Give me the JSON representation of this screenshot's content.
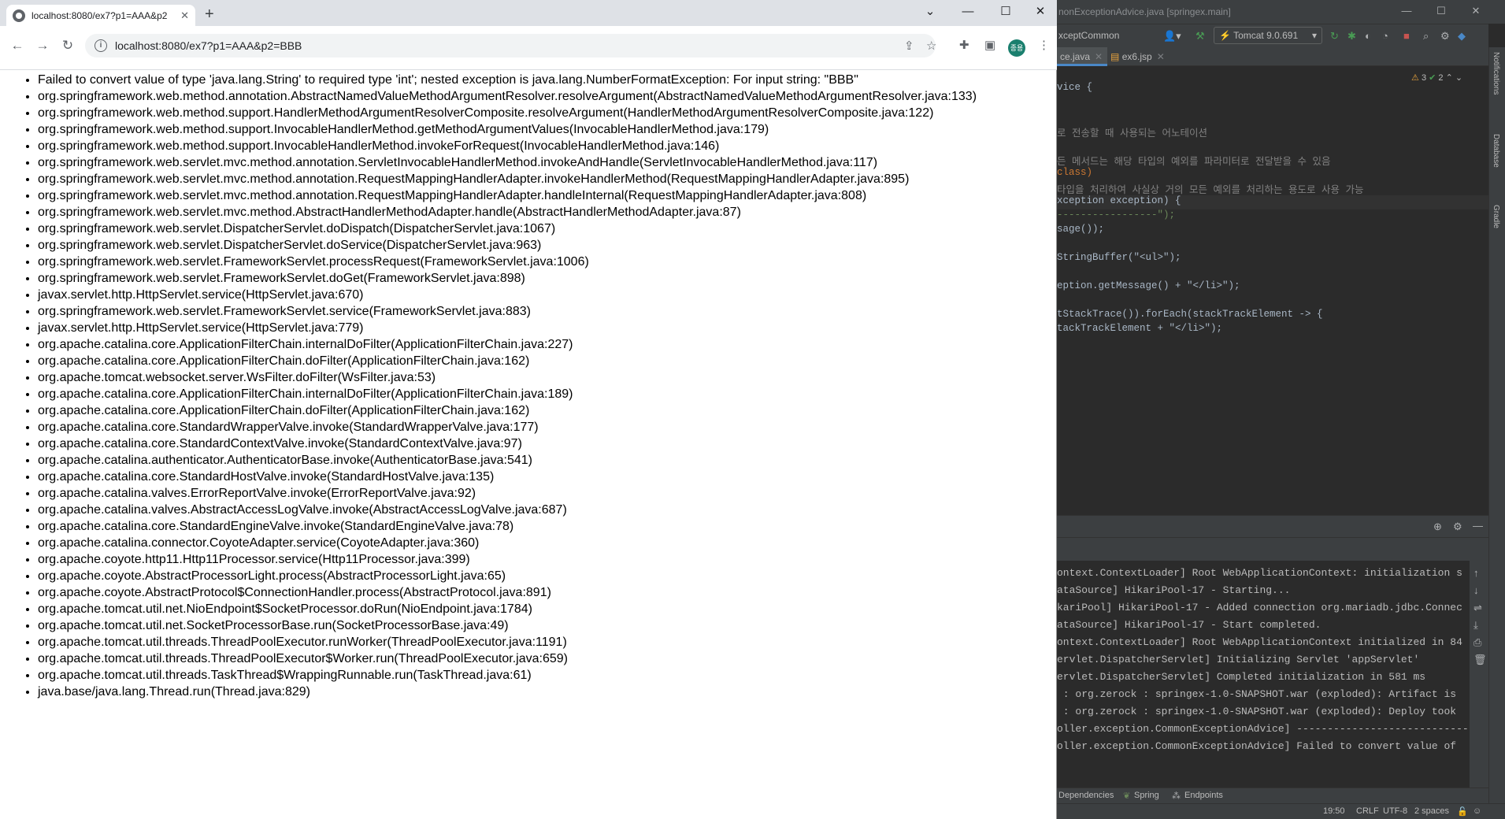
{
  "browser": {
    "tab_title": "localhost:8080/ex7?p1=AAA&p2",
    "url": "localhost:8080/ex7?p1=AAA&p2=BBB",
    "avatar_text": "종용",
    "icons": {
      "favicon": "globe-icon",
      "tab_close": "close-icon",
      "new_tab": "plus-icon",
      "back": "arrow-left-icon",
      "forward": "arrow-right-icon",
      "reload": "reload-icon",
      "site_info": "info-icon",
      "share": "share-icon",
      "bookmark": "star-icon",
      "extensions": "puzzle-icon",
      "side_panel": "side-panel-icon",
      "menu": "kebab-menu-icon"
    },
    "stack_trace": [
      "Failed to convert value of type 'java.lang.String' to required type 'int'; nested exception is java.lang.NumberFormatException: For input string: \"BBB\"",
      "org.springframework.web.method.annotation.AbstractNamedValueMethodArgumentResolver.resolveArgument(AbstractNamedValueMethodArgumentResolver.java:133)",
      "org.springframework.web.method.support.HandlerMethodArgumentResolverComposite.resolveArgument(HandlerMethodArgumentResolverComposite.java:122)",
      "org.springframework.web.method.support.InvocableHandlerMethod.getMethodArgumentValues(InvocableHandlerMethod.java:179)",
      "org.springframework.web.method.support.InvocableHandlerMethod.invokeForRequest(InvocableHandlerMethod.java:146)",
      "org.springframework.web.servlet.mvc.method.annotation.ServletInvocableHandlerMethod.invokeAndHandle(ServletInvocableHandlerMethod.java:117)",
      "org.springframework.web.servlet.mvc.method.annotation.RequestMappingHandlerAdapter.invokeHandlerMethod(RequestMappingHandlerAdapter.java:895)",
      "org.springframework.web.servlet.mvc.method.annotation.RequestMappingHandlerAdapter.handleInternal(RequestMappingHandlerAdapter.java:808)",
      "org.springframework.web.servlet.mvc.method.AbstractHandlerMethodAdapter.handle(AbstractHandlerMethodAdapter.java:87)",
      "org.springframework.web.servlet.DispatcherServlet.doDispatch(DispatcherServlet.java:1067)",
      "org.springframework.web.servlet.DispatcherServlet.doService(DispatcherServlet.java:963)",
      "org.springframework.web.servlet.FrameworkServlet.processRequest(FrameworkServlet.java:1006)",
      "org.springframework.web.servlet.FrameworkServlet.doGet(FrameworkServlet.java:898)",
      "javax.servlet.http.HttpServlet.service(HttpServlet.java:670)",
      "org.springframework.web.servlet.FrameworkServlet.service(FrameworkServlet.java:883)",
      "javax.servlet.http.HttpServlet.service(HttpServlet.java:779)",
      "org.apache.catalina.core.ApplicationFilterChain.internalDoFilter(ApplicationFilterChain.java:227)",
      "org.apache.catalina.core.ApplicationFilterChain.doFilter(ApplicationFilterChain.java:162)",
      "org.apache.tomcat.websocket.server.WsFilter.doFilter(WsFilter.java:53)",
      "org.apache.catalina.core.ApplicationFilterChain.internalDoFilter(ApplicationFilterChain.java:189)",
      "org.apache.catalina.core.ApplicationFilterChain.doFilter(ApplicationFilterChain.java:162)",
      "org.apache.catalina.core.StandardWrapperValve.invoke(StandardWrapperValve.java:177)",
      "org.apache.catalina.core.StandardContextValve.invoke(StandardContextValve.java:97)",
      "org.apache.catalina.authenticator.AuthenticatorBase.invoke(AuthenticatorBase.java:541)",
      "org.apache.catalina.core.StandardHostValve.invoke(StandardHostValve.java:135)",
      "org.apache.catalina.valves.ErrorReportValve.invoke(ErrorReportValve.java:92)",
      "org.apache.catalina.valves.AbstractAccessLogValve.invoke(AbstractAccessLogValve.java:687)",
      "org.apache.catalina.core.StandardEngineValve.invoke(StandardEngineValve.java:78)",
      "org.apache.catalina.connector.CoyoteAdapter.service(CoyoteAdapter.java:360)",
      "org.apache.coyote.http11.Http11Processor.service(Http11Processor.java:399)",
      "org.apache.coyote.AbstractProcessorLight.process(AbstractProcessorLight.java:65)",
      "org.apache.coyote.AbstractProtocol$ConnectionHandler.process(AbstractProtocol.java:891)",
      "org.apache.tomcat.util.net.NioEndpoint$SocketProcessor.doRun(NioEndpoint.java:1784)",
      "org.apache.tomcat.util.net.SocketProcessorBase.run(SocketProcessorBase.java:49)",
      "org.apache.tomcat.util.threads.ThreadPoolExecutor.runWorker(ThreadPoolExecutor.java:1191)",
      "org.apache.tomcat.util.threads.ThreadPoolExecutor$Worker.run(ThreadPoolExecutor.java:659)",
      "org.apache.tomcat.util.threads.TaskThread$WrappingRunnable.run(TaskThread.java:61)",
      "java.base/java.lang.Thread.run(Thread.java:829)"
    ]
  },
  "ide": {
    "window_title": "nonExceptionAdvice.java [springex.main]",
    "config_name": "xceptCommon",
    "run_config": "Tomcat 9.0.691",
    "tabs": [
      "ce.java",
      "ex6.jsp"
    ],
    "inspection": {
      "warnings": "3",
      "ok": "2"
    },
    "code_lines": [
      "vice {",
      "",
      "",
      "로 전송할 때 사용되는 어노테이션",
      "",
      "든 메서드는 해당 타입의 예외를 파라미터로 전달받을 수 있음",
      "class)",
      "타입을 처리하여 사실상 거의 모든 예외를 처리하는 용도로 사용 가능",
      "xception exception) {",
      "-----------------\");",
      "sage());",
      "",
      "StringBuffer(\"<ul>\");",
      "",
      "eption.getMessage() + \"</li>\");",
      "",
      "tStackTrace()).forEach(stackTrackElement -> {",
      "tackTrackElement + \"</li>\");"
    ],
    "console_lines": [
      "ontext.ContextLoader] Root WebApplicationContext: initialization s",
      "ataSource] HikariPool-17 - Starting...",
      "kariPool] HikariPool-17 - Added connection org.mariadb.jdbc.Connec",
      "ataSource] HikariPool-17 - Start completed.",
      "ontext.ContextLoader] Root WebApplicationContext initialized in 84",
      "ervlet.DispatcherServlet] Initializing Servlet 'appServlet'",
      "ervlet.DispatcherServlet] Completed initialization in 581 ms",
      " : org.zerock : springex-1.0-SNAPSHOT.war (exploded): Artifact is",
      " : org.zerock : springex-1.0-SNAPSHOT.war (exploded): Deploy took",
      "oller.exception.CommonExceptionAdvice] ----------------------------",
      "oller.exception.CommonExceptionAdvice] Failed to convert value of"
    ],
    "right_strip": [
      "Notifications",
      "Database",
      "Gradle"
    ],
    "tool_windows": [
      "Dependencies",
      "Spring",
      "Endpoints"
    ],
    "status": {
      "position": "19:50",
      "line_sep": "CRLF",
      "encoding": "UTF-8",
      "indent": "2 spaces"
    }
  }
}
